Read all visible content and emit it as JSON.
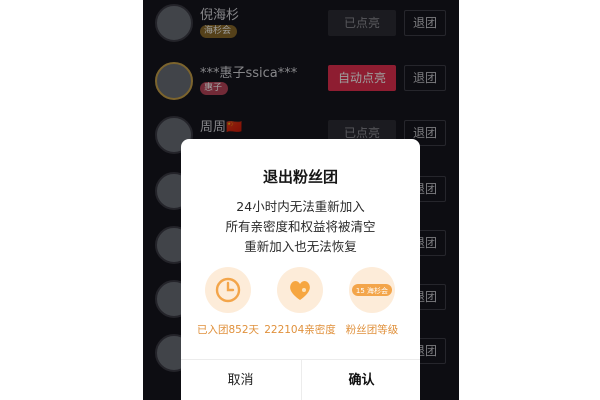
{
  "fans": [
    {
      "name": "倪海杉",
      "badge": "海杉会",
      "badge_color": "gold",
      "light_label": "已点亮",
      "light_state": "lit",
      "quit_label": "退团"
    },
    {
      "name": "***惠子ssica***",
      "badge": "惠子",
      "badge_color": "red",
      "light_label": "自动点亮",
      "light_state": "auto",
      "quit_label": "退团"
    },
    {
      "name": "周周🇨🇳",
      "badge": "",
      "badge_color": "",
      "light_label": "已点亮",
      "light_state": "lit",
      "quit_label": "退团"
    },
    {
      "name": "",
      "badge": "",
      "badge_color": "",
      "light_label": "",
      "light_state": "",
      "quit_label": "退团"
    },
    {
      "name": "",
      "badge": "",
      "badge_color": "",
      "light_label": "",
      "light_state": "",
      "quit_label": "退团"
    },
    {
      "name": "",
      "badge": "",
      "badge_color": "",
      "light_label": "",
      "light_state": "",
      "quit_label": "退团"
    },
    {
      "name": "",
      "badge": "",
      "badge_color": "",
      "light_label": "",
      "light_state": "",
      "quit_label": "退团"
    }
  ],
  "dialog": {
    "title": "退出粉丝团",
    "lines": [
      "24小时内无法重新加入",
      "所有亲密度和权益将被清空",
      "重新加入也无法恢复"
    ],
    "features": [
      {
        "icon": "clock-icon",
        "label": "已入团852天"
      },
      {
        "icon": "heart-icon",
        "label": "222104亲密度"
      },
      {
        "icon": "fan-level-badge-icon",
        "badge_text": "15 海杉会",
        "label": "粉丝团等级"
      }
    ],
    "cancel_label": "取消",
    "confirm_label": "确认"
  },
  "colors": {
    "accent_red": "#e5304f",
    "dialog_orange": "#e0913c",
    "background": "#16161e"
  }
}
